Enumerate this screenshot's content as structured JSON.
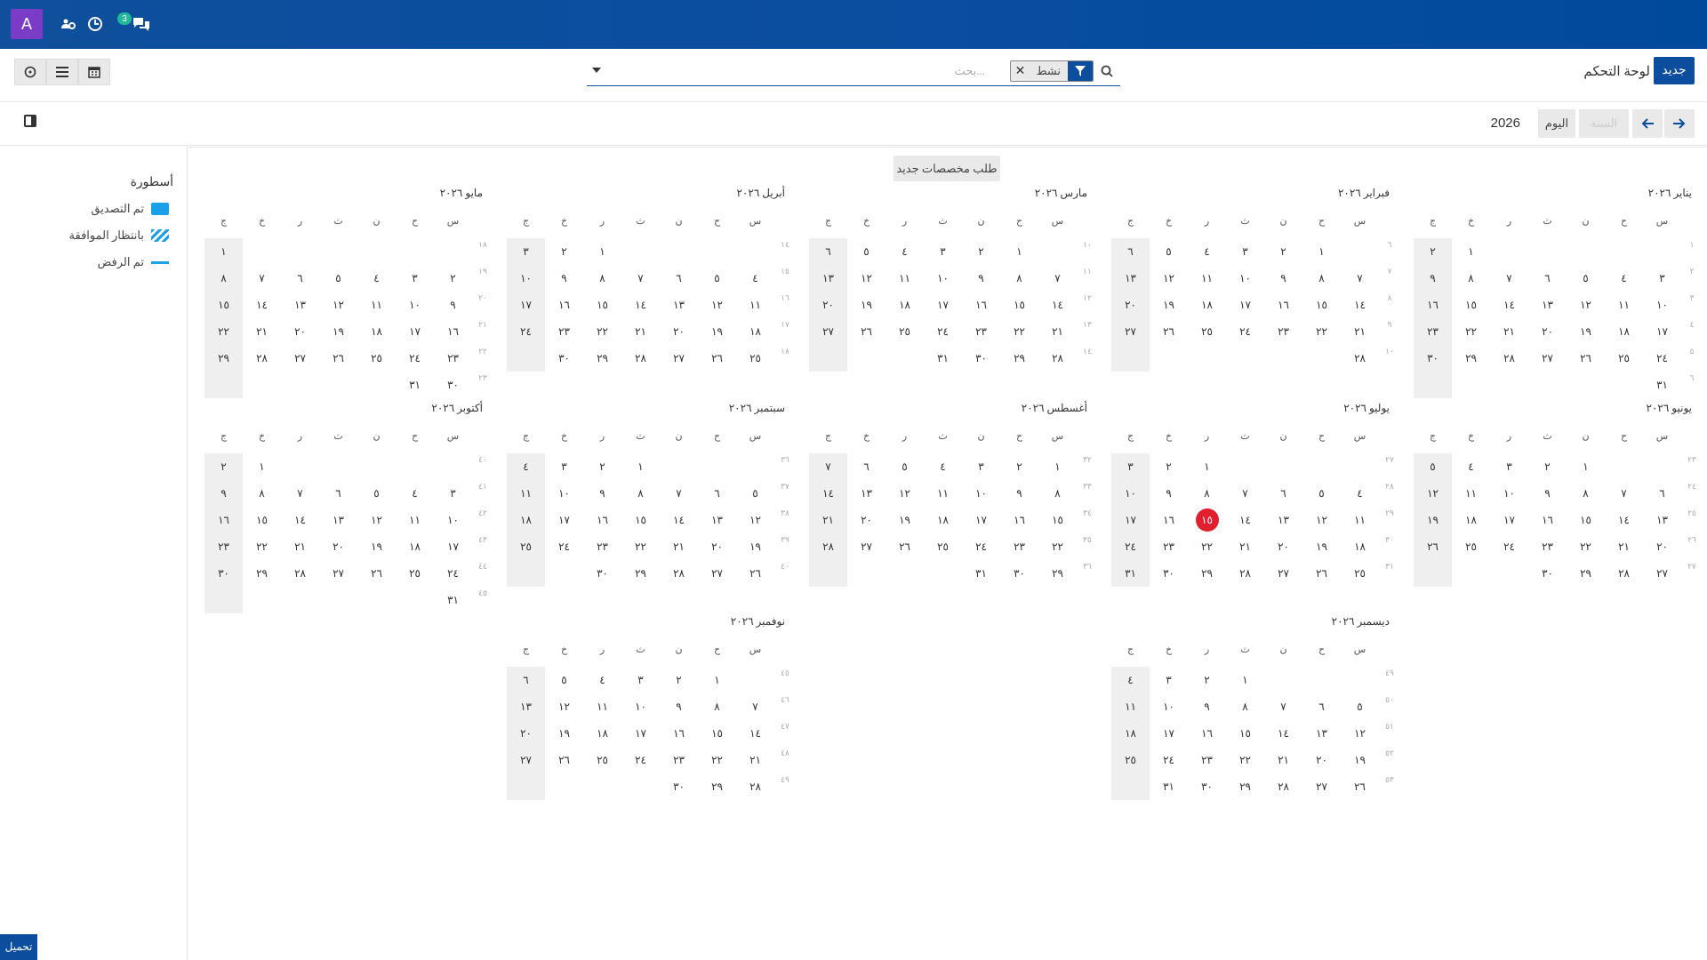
{
  "topbar": {
    "avatar_letter": "A",
    "badge_count": "3",
    "icons": [
      "users-cog-icon",
      "clock-icon",
      "chat-icon"
    ]
  },
  "control_panel": {
    "new_button": "جديد",
    "breadcrumb": "لوحة التحكم",
    "search_placeholder": "بحث...",
    "facet_value": "نشط",
    "view_icons": [
      "calendar-icon",
      "list-icon",
      "activity-icon"
    ]
  },
  "nav": {
    "today": "اليوم",
    "year": "2026",
    "scale": "السنة"
  },
  "request_button": "طلب مخصصات جديد",
  "legend": {
    "title": "أسطورة",
    "items": [
      {
        "label": "تم التصديق",
        "color": "#1aa0e8",
        "style": "solid"
      },
      {
        "label": "بانتظار الموافقة",
        "color": "#1aa0e8",
        "style": "hatched"
      },
      {
        "label": "تم الرفض",
        "color": "#1aa0e8",
        "style": "line"
      }
    ]
  },
  "weekday_headers": [
    "س",
    "ح",
    "ن",
    "ث",
    "ر",
    "خ",
    "ج"
  ],
  "months": [
    {
      "name": "يناير ٢٠٢٦",
      "offset": 5,
      "days": 31,
      "first_week": 1
    },
    {
      "name": "فبراير ٢٠٢٦",
      "offset": 1,
      "days": 28,
      "first_week": 6
    },
    {
      "name": "مارس ٢٠٢٦",
      "offset": 1,
      "days": 31,
      "first_week": 10
    },
    {
      "name": "أبريل ٢٠٢٦",
      "offset": 4,
      "days": 30,
      "first_week": 14
    },
    {
      "name": "مايو ٢٠٢٦",
      "offset": 6,
      "days": 31,
      "first_week": 18
    },
    {
      "name": "يونيو ٢٠٢٦",
      "offset": 2,
      "days": 30,
      "first_week": 23
    },
    {
      "name": "يوليو ٢٠٢٦",
      "offset": 4,
      "days": 31,
      "first_week": 27,
      "today": 15
    },
    {
      "name": "أغسطس ٢٠٢٦",
      "offset": 0,
      "days": 31,
      "first_week": 32
    },
    {
      "name": "سبتمبر ٢٠٢٦",
      "offset": 3,
      "days": 30,
      "first_week": 36
    },
    {
      "name": "أكتوبر ٢٠٢٦",
      "offset": 5,
      "days": 31,
      "first_week": 40
    },
    {
      "name": "نوفمبر ٢٠٢٦",
      "offset": 1,
      "days": 30,
      "first_week": 45
    },
    {
      "name": "ديسمبر ٢٠٢٦",
      "offset": 3,
      "days": 31,
      "first_week": 49
    }
  ],
  "footer_button": "تحميل"
}
